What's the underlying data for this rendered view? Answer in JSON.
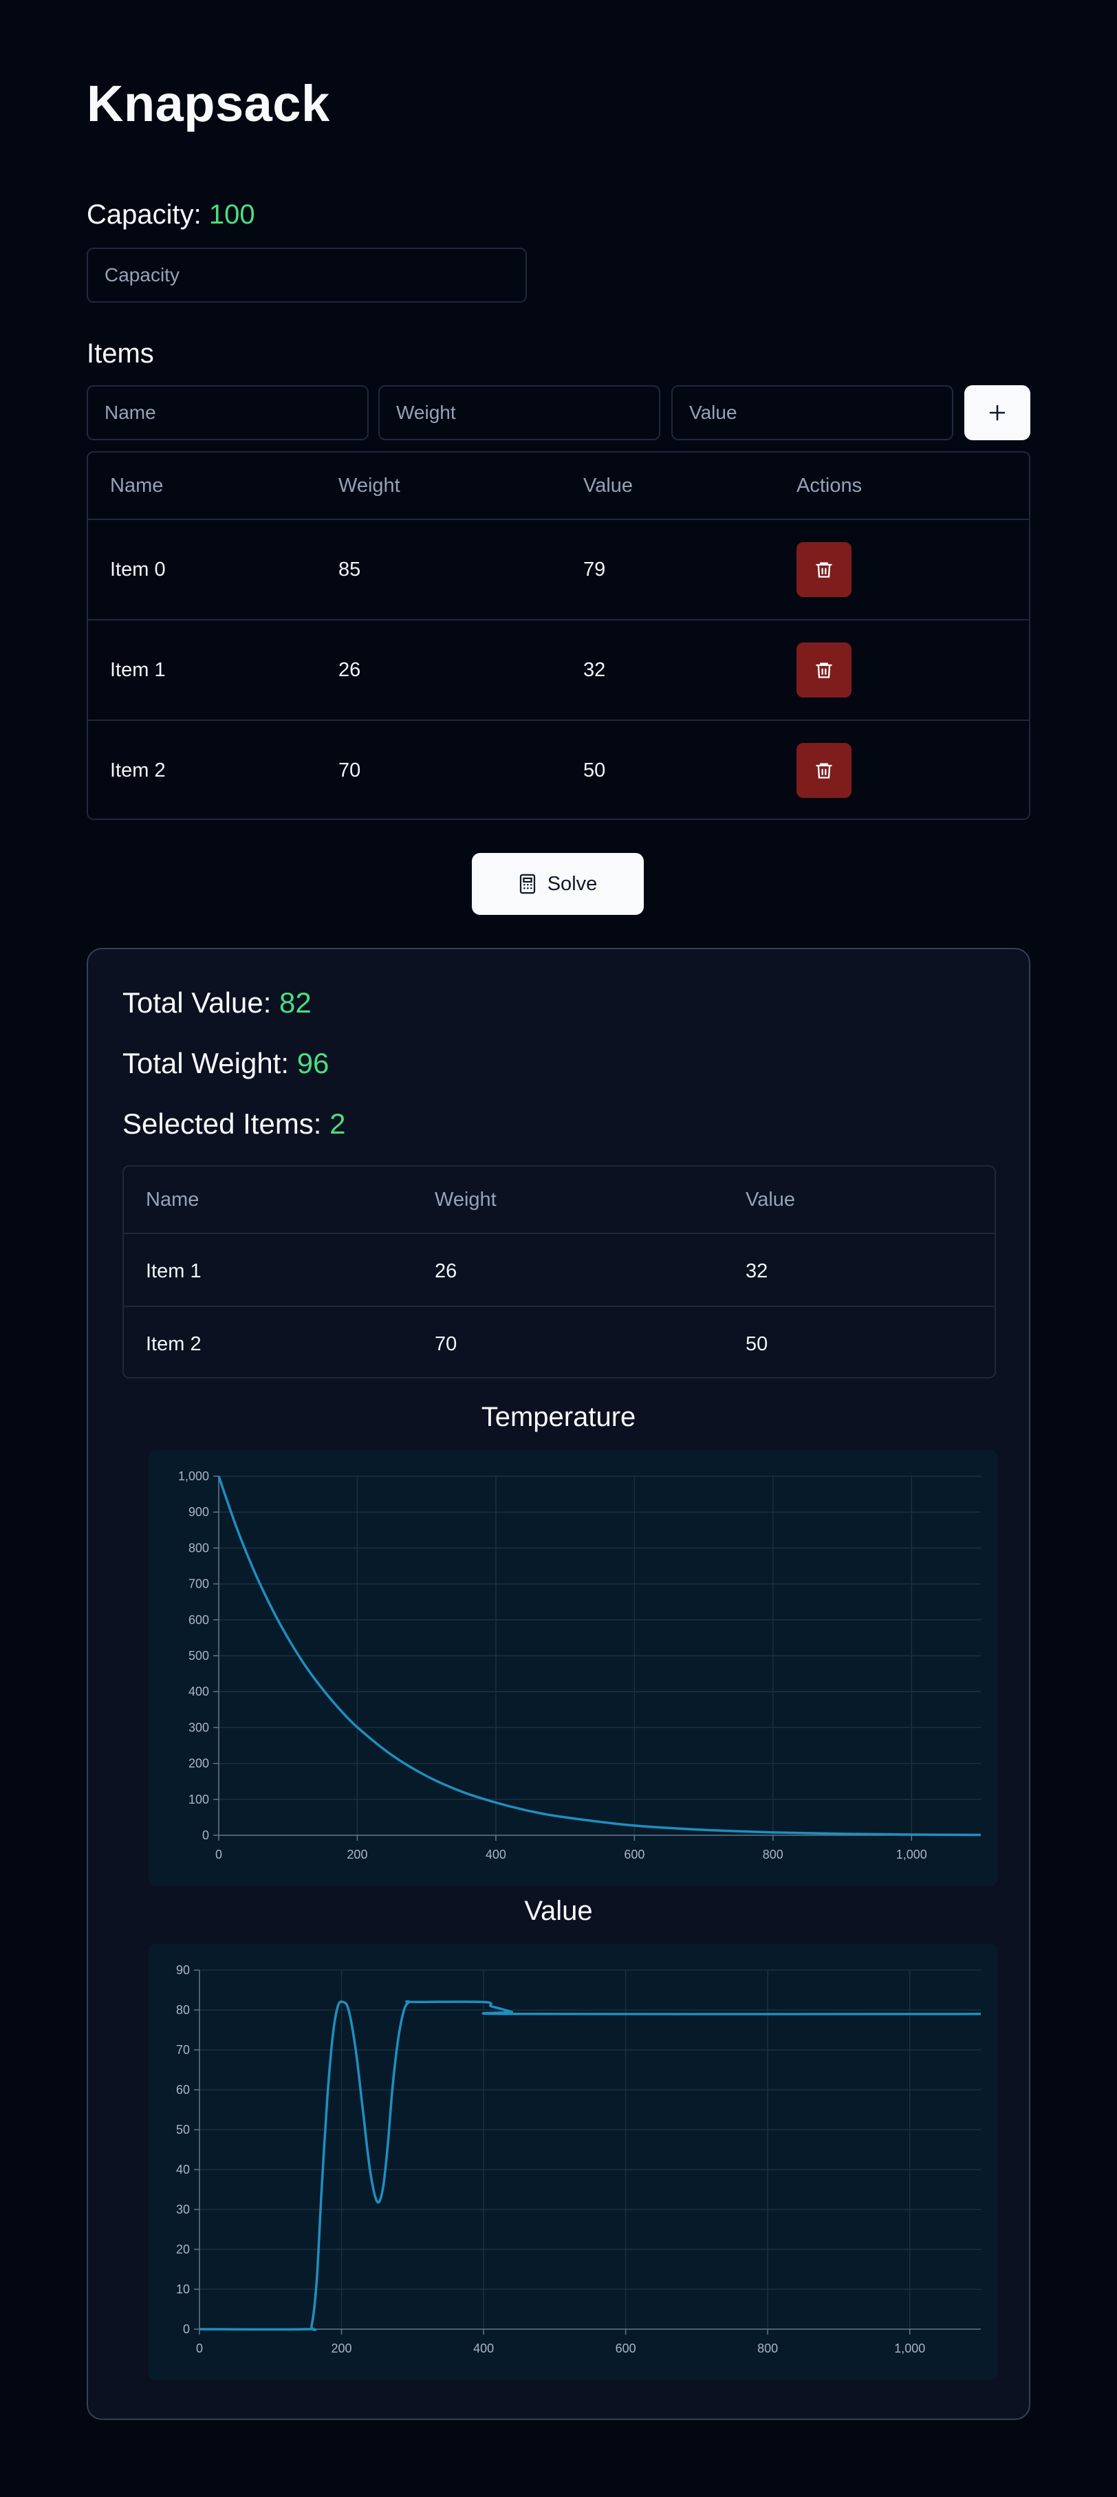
{
  "page_title": "Knapsack",
  "capacity": {
    "label": "Capacity: ",
    "value": "100",
    "placeholder": "Capacity"
  },
  "items_section": {
    "label": "Items",
    "name_placeholder": "Name",
    "weight_placeholder": "Weight",
    "value_placeholder": "Value",
    "add_icon": "plus-icon"
  },
  "items_table": {
    "headers": [
      "Name",
      "Weight",
      "Value",
      "Actions"
    ],
    "rows": [
      {
        "name": "Item 0",
        "weight": "85",
        "value": "79"
      },
      {
        "name": "Item 1",
        "weight": "26",
        "value": "32"
      },
      {
        "name": "Item 2",
        "weight": "70",
        "value": "50"
      }
    ],
    "delete_icon": "trash-icon"
  },
  "solve_button": {
    "label": "Solve",
    "icon": "calculator-icon"
  },
  "results": {
    "total_value_label": "Total Value: ",
    "total_value": "82",
    "total_weight_label": "Total Weight: ",
    "total_weight": "96",
    "selected_items_label": "Selected Items: ",
    "selected_items": "2",
    "headers": [
      "Name",
      "Weight",
      "Value"
    ],
    "rows": [
      {
        "name": "Item 1",
        "weight": "26",
        "value": "32"
      },
      {
        "name": "Item 2",
        "weight": "70",
        "value": "50"
      }
    ]
  },
  "colors": {
    "accent_green": "#4ade80",
    "line": "#1f8fbf",
    "delete": "#7f1d1d"
  },
  "chart_data": [
    {
      "type": "line",
      "title": "Temperature",
      "xlim": [
        0,
        1100
      ],
      "ylim": [
        0,
        1000
      ],
      "xticks": [
        0,
        200,
        400,
        600,
        800,
        1000
      ],
      "xtick_labels": [
        "0",
        "200",
        "400",
        "600",
        "800",
        "1,000"
      ],
      "yticks": [
        0,
        100,
        200,
        300,
        400,
        500,
        600,
        700,
        800,
        900,
        1000
      ],
      "ytick_labels": [
        "0",
        "100",
        "200",
        "300",
        "400",
        "500",
        "600",
        "700",
        "800",
        "900",
        "1,000"
      ],
      "grid": true,
      "series": [
        {
          "x": [
            0,
            25,
            50,
            75,
            100,
            125,
            150,
            175,
            200,
            250,
            300,
            350,
            400,
            450,
            500,
            600,
            700,
            800,
            900,
            1000,
            1100
          ],
          "y": [
            1000,
            861,
            741,
            638,
            549,
            472,
            407,
            350,
            301,
            223,
            165,
            122,
            91,
            67,
            50,
            27,
            15,
            8,
            4,
            2,
            1
          ]
        }
      ]
    },
    {
      "type": "line",
      "title": "Value",
      "xlim": [
        0,
        1100
      ],
      "ylim": [
        0,
        90
      ],
      "xticks": [
        0,
        200,
        400,
        600,
        800,
        1000
      ],
      "xtick_labels": [
        "0",
        "200",
        "400",
        "600",
        "800",
        "1,000"
      ],
      "yticks": [
        0,
        10,
        20,
        30,
        40,
        50,
        60,
        70,
        80,
        90
      ],
      "ytick_labels": [
        "0",
        "10",
        "20",
        "30",
        "40",
        "50",
        "60",
        "70",
        "80",
        "90"
      ],
      "grid": true,
      "series": [
        {
          "x": [
            0,
            150,
            158,
            165,
            172,
            180,
            188,
            195,
            202,
            210,
            220,
            230,
            240,
            250,
            258,
            265,
            272,
            280,
            288,
            295,
            300,
            400,
            410,
            420,
            430,
            440,
            450,
            1100
          ],
          "y": [
            0,
            0,
            1,
            12,
            35,
            58,
            74,
            81,
            82,
            80,
            70,
            55,
            40,
            32,
            35,
            46,
            61,
            73,
            80,
            82,
            82,
            82,
            81,
            80.5,
            80,
            79.5,
            79,
            79
          ]
        }
      ]
    }
  ]
}
